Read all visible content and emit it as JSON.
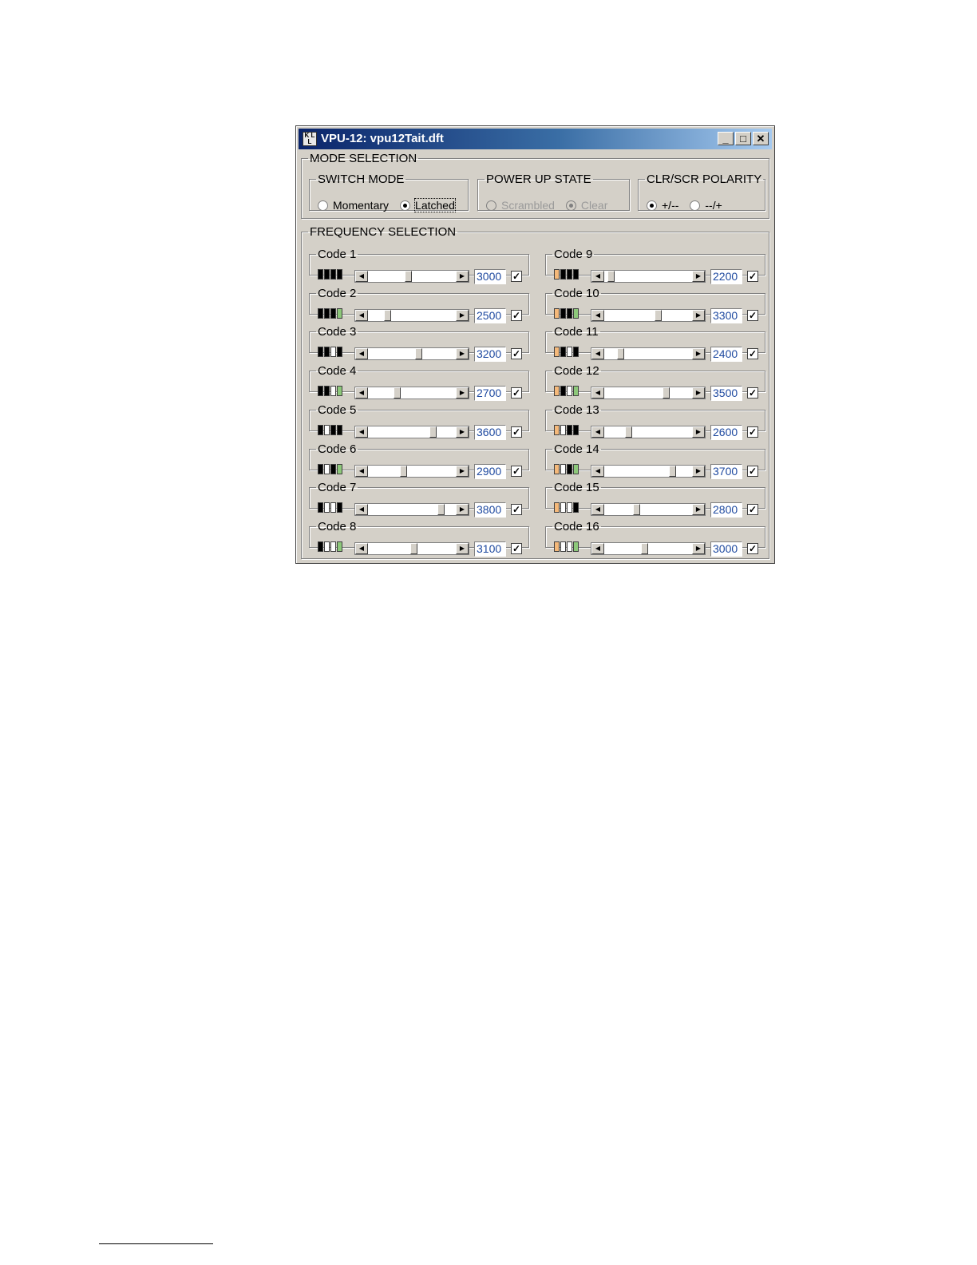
{
  "window": {
    "title": "VPU-12: vpu12Tait.dft",
    "icon": "kl-app-icon",
    "minimize": "_",
    "maximize": "□",
    "close": "✕"
  },
  "mode_selection": {
    "label": "MODE SELECTION",
    "switch_mode": {
      "label": "SWITCH MODE",
      "options": [
        {
          "label": "Momentary",
          "checked": false
        },
        {
          "label": "Latched",
          "checked": true
        }
      ]
    },
    "power_up_state": {
      "label": "POWER UP STATE",
      "disabled": true,
      "options": [
        {
          "label": "Scrambled",
          "checked": false
        },
        {
          "label": "Clear",
          "checked": true
        }
      ]
    },
    "polarity": {
      "label": "CLR/SCR POLARITY",
      "options": [
        {
          "label": "+/--",
          "checked": true
        },
        {
          "label": "--/+",
          "checked": false
        }
      ]
    }
  },
  "frequency_selection": {
    "label": "FREQUENCY SELECTION",
    "codes": [
      {
        "label": "Code 1",
        "value": "3000",
        "slider": 0.46,
        "checked": true,
        "dip": "kkkk"
      },
      {
        "label": "Code 2",
        "value": "2500",
        "slider": 0.2,
        "checked": true,
        "dip": "kkkg"
      },
      {
        "label": "Code 3",
        "value": "3200",
        "slider": 0.58,
        "checked": true,
        "dip": "kkwk"
      },
      {
        "label": "Code 4",
        "value": "2700",
        "slider": 0.32,
        "checked": true,
        "dip": "kkwg"
      },
      {
        "label": "Code 5",
        "value": "3600",
        "slider": 0.76,
        "checked": true,
        "dip": "kwkk"
      },
      {
        "label": "Code 6",
        "value": "2900",
        "slider": 0.4,
        "checked": true,
        "dip": "kwkg"
      },
      {
        "label": "Code 7",
        "value": "3800",
        "slider": 0.86,
        "checked": true,
        "dip": "kwwk"
      },
      {
        "label": "Code 8",
        "value": "3100",
        "slider": 0.52,
        "checked": true,
        "dip": "kwwg"
      },
      {
        "label": "Code 9",
        "value": "2200",
        "slider": 0.04,
        "checked": true,
        "dip": "okkk"
      },
      {
        "label": "Code 10",
        "value": "3300",
        "slider": 0.62,
        "checked": true,
        "dip": "okkg"
      },
      {
        "label": "Code 11",
        "value": "2400",
        "slider": 0.16,
        "checked": true,
        "dip": "okwk"
      },
      {
        "label": "Code 12",
        "value": "3500",
        "slider": 0.72,
        "checked": true,
        "dip": "okwg"
      },
      {
        "label": "Code 13",
        "value": "2600",
        "slider": 0.26,
        "checked": true,
        "dip": "owkk"
      },
      {
        "label": "Code 14",
        "value": "3700",
        "slider": 0.8,
        "checked": true,
        "dip": "owkg"
      },
      {
        "label": "Code 15",
        "value": "2800",
        "slider": 0.36,
        "checked": true,
        "dip": "owwk"
      },
      {
        "label": "Code 16",
        "value": "3000",
        "slider": 0.46,
        "checked": true,
        "dip": "owwg"
      }
    ]
  },
  "colors": {
    "titlebar_start": "#0a246a",
    "titlebar_end": "#a6caf0",
    "value_text": "#1f4aa0",
    "dip_green": "#8dc87a",
    "dip_orange": "#f5b97a"
  }
}
